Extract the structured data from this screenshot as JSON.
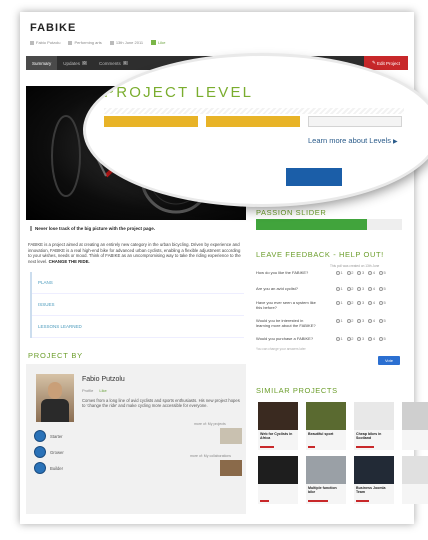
{
  "project": {
    "title": "FABIKE",
    "author_short": "Fabio Putzolu",
    "category": "Performing arts",
    "date": "13th June 2011",
    "like": "Like"
  },
  "tabs": [
    {
      "label": "Summary",
      "count": ""
    },
    {
      "label": "Updates",
      "count": "0"
    },
    {
      "label": "Comments",
      "count": "0"
    }
  ],
  "edit_button": "Edit Project",
  "caption": "Never lose track of the big picture with the project page.",
  "description": {
    "text": "FABIKE is a project aimed at creating an entirely new category in the urban bicycling. Driven by experience and innovation, FABIKE is a real high-end bike for advanced urban cyclists, enabling a flexible adjustment according to your wishes, needs or mood. Think of FABIKE as an uncompromising way to take the riding experience to the next level.",
    "emphasis": "CHANGE THE RIDE."
  },
  "plan_sections": [
    "PLANS",
    "ISSUES",
    "LESSONS LEARNED"
  ],
  "project_by": {
    "heading": "PROJECT BY",
    "name": "Fabio Putzolu",
    "profile": "Profile",
    "like": "Like",
    "bio": "Comes from a long line of avid cyclists and sports enthusiasts. His new project hopes to 'change the ride' and make cycling more accessible for everyone.",
    "badges": [
      "Starter",
      "Grower",
      "Builder"
    ],
    "more_projects": "more of: My projects",
    "more_collaborations": "more of: My collaborations"
  },
  "project_level": {
    "heading": "PROJECT LEVEL",
    "level": 2,
    "max_level": 3,
    "learn_more": "Learn more about Levels",
    "colors": {
      "filled": "#e8b327",
      "empty": "#f4f4f4"
    }
  },
  "passion_slider": {
    "heading": "PASSION SLIDER",
    "value_percent": 76,
    "color": "#41a43c"
  },
  "feedback": {
    "heading": "LEAVE FEEDBACK - HELP OUT!",
    "note": "This poll was created on 13th June",
    "questions": [
      "How do you like the FABIKE?",
      "Are you an avid cyclist?",
      "Have you ever seen a system like this before?",
      "Would you be interested in learning more about the FABIKE?",
      "Would you purchase a FABIKE?"
    ],
    "scale": [
      "1",
      "2",
      "3",
      "4",
      "5"
    ],
    "footer": "You can change your answers later",
    "vote_button": "Vote"
  },
  "similar": {
    "heading": "SIMILAR PROJECTS",
    "items": [
      {
        "title": "Web for Cyclists in Africa",
        "progress": 40
      },
      {
        "title": "Beautiful sport",
        "progress": 20
      },
      {
        "title": "Cheap bikes in Scotland",
        "progress": 50
      },
      {
        "title": "",
        "progress": 0
      },
      {
        "title": "",
        "progress": 25
      },
      {
        "title": "Multiple function bike",
        "progress": 55
      },
      {
        "title": "Business Joomla Team",
        "progress": 35
      },
      {
        "title": "",
        "progress": 0
      }
    ]
  },
  "accent_colors": {
    "green": "#7aad2e",
    "red": "#c8282a",
    "blue": "#2b6fd1"
  }
}
